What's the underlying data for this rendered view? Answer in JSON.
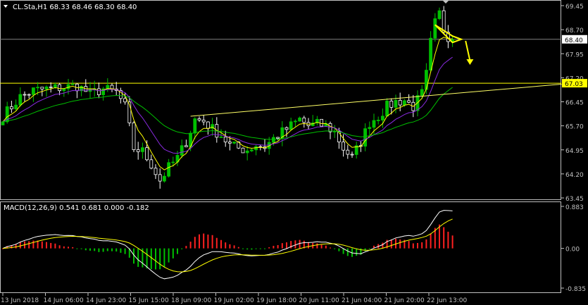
{
  "symbol_header": "CL.Sta,H1  68.33 68.46 68.30 68.40",
  "macd_header": "MACD(12,26,9) 0.541 0.681 0.000 -0.182",
  "colors": {
    "background": "#000000",
    "axis": "#c0c0c0",
    "bull_candle": "#00c000",
    "bear_candle": "#ffffff",
    "ma_fast": "#ffff00",
    "ma_slow1": "#8a2be2",
    "ma_slow2": "#00c000",
    "trendline": "#ffff66",
    "level_line": "#ffff00",
    "hist_pos": "#ff2020",
    "hist_neg": "#00c000",
    "macd_line": "#ffffff",
    "signal_line": "#ffff00",
    "arrow": "#ffff00"
  },
  "chart_data": [
    {
      "type": "candlestick",
      "title": "CL.Sta,H1",
      "ohlc_last": {
        "open": 68.33,
        "high": 68.46,
        "low": 68.3,
        "close": 68.4
      },
      "y_ticks": [
        "69.45",
        "68.70",
        "67.95",
        "67.20",
        "66.45",
        "65.70",
        "64.95",
        "64.20",
        "63.45"
      ],
      "ylim": [
        63.45,
        69.45
      ],
      "x_ticks": [
        "13 Jun 2018",
        "14 Jun 06:00",
        "14 Jun 23:00",
        "15 Jun 15:00",
        "18 Jun 09:00",
        "19 Jun 02:00",
        "19 Jun 18:00",
        "20 Jun 11:00",
        "21 Jun 04:00",
        "21 Jun 20:00",
        "22 Jun 13:00"
      ],
      "price_labels": {
        "current": "68.40",
        "level": "67.03"
      },
      "level_line": 67.03,
      "current_price_line": 68.4,
      "close_path": [
        [
          0,
          66.0
        ],
        [
          4,
          66.6
        ],
        [
          7,
          66.8
        ],
        [
          10,
          66.85
        ],
        [
          14,
          66.9
        ],
        [
          17,
          66.95
        ],
        [
          20,
          66.7
        ],
        [
          23,
          66.85
        ],
        [
          26,
          66.75
        ],
        [
          28,
          66.3
        ],
        [
          30,
          65.0
        ],
        [
          32,
          64.9
        ],
        [
          34,
          64.5
        ],
        [
          36,
          64.0
        ],
        [
          38,
          64.4
        ],
        [
          40,
          64.7
        ],
        [
          42,
          65.2
        ],
        [
          44,
          65.9
        ],
        [
          46,
          65.85
        ],
        [
          48,
          65.6
        ],
        [
          50,
          65.4
        ],
        [
          52,
          65.1
        ],
        [
          54,
          65.0
        ],
        [
          56,
          64.95
        ],
        [
          58,
          65.1
        ],
        [
          60,
          65.05
        ],
        [
          62,
          65.3
        ],
        [
          64,
          65.5
        ],
        [
          66,
          65.7
        ],
        [
          68,
          65.9
        ],
        [
          70,
          65.7
        ],
        [
          72,
          65.75
        ],
        [
          74,
          65.7
        ],
        [
          76,
          65.5
        ],
        [
          78,
          65.0
        ],
        [
          80,
          64.7
        ],
        [
          82,
          65.2
        ],
        [
          84,
          65.8
        ],
        [
          86,
          66.0
        ],
        [
          88,
          66.3
        ],
        [
          90,
          66.45
        ],
        [
          92,
          66.5
        ],
        [
          94,
          66.3
        ],
        [
          96,
          66.7
        ],
        [
          97,
          67.3
        ],
        [
          98,
          68.3
        ],
        [
          99,
          68.9
        ],
        [
          100,
          69.2
        ],
        [
          101,
          68.7
        ],
        [
          102,
          68.5
        ],
        [
          103,
          68.4
        ]
      ],
      "n_bars": 104,
      "annotations": {
        "trendline": {
          "from": [
            43,
            66.0
          ],
          "to": [
            128,
            67.0
          ]
        },
        "triangle": [
          [
            99,
            68.85
          ],
          [
            103,
            68.3
          ],
          [
            105,
            68.4
          ],
          [
            103,
            68.5
          ]
        ],
        "arrow": {
          "from": [
            106,
            68.35
          ],
          "to": [
            107,
            67.6
          ]
        }
      }
    },
    {
      "type": "macd",
      "title": "MACD(12,26,9)",
      "values": {
        "macd": 0.541,
        "signal": 0.681,
        "value3": 0.0,
        "value4": -0.182
      },
      "y_ticks": [
        "0.883",
        "0.00",
        "-0.835"
      ],
      "ylim": [
        -0.835,
        0.883
      ]
    }
  ]
}
